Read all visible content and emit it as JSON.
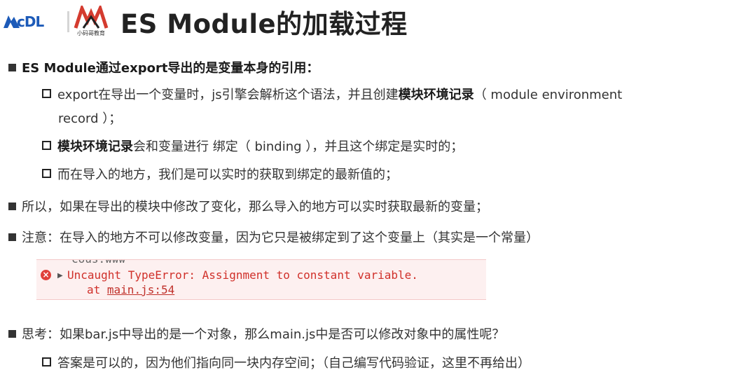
{
  "header": {
    "logo_left_text": "cDL",
    "logo_right_caption": "小码哥教育",
    "title": "ES Module的加载过程"
  },
  "bullets": {
    "b1": {
      "pre": "ES Module通过export导出的是变量本身的引用："
    },
    "b1a": {
      "pre": "export在导出一个变量时，js引擎会解析这个语法，并且创建",
      "bold": "模块环境记录",
      "post": "（ module environment",
      "line2": "record ）；"
    },
    "b1b": {
      "bold": "模块环境记录",
      "post": "会和变量进行 绑定（ binding ），并且这个绑定是实时的；"
    },
    "b1c": {
      "text": "而在导入的地方，我们是可以实时的获取到绑定的最新值的；"
    },
    "b2": {
      "text": "所以，如果在导出的模块中修改了变化，那么导入的地方可以实时获取最新的变量；"
    },
    "b3": {
      "text": "注意：在导入的地方不可以修改变量，因为它只是被绑定到了这个变量上（其实是一个常量）"
    },
    "b4": {
      "text": "思考：如果bar.js中导出的是一个对象，那么main.js中是否可以修改对象中的属性呢？"
    },
    "b4a": {
      "text": "答案是可以的，因为他们指向同一块内存空间；（自己编写代码验证，这里不再给出）"
    }
  },
  "console": {
    "cut_text": "cous.www",
    "error_message": "Uncaught TypeError: Assignment to constant variable.",
    "at_prefix": "at ",
    "location": "main.js:54"
  }
}
